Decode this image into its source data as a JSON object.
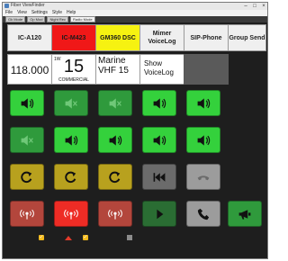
{
  "window": {
    "title": "Fiber ViewFinder"
  },
  "menu": [
    "File",
    "View",
    "Settings",
    "Style",
    "Help"
  ],
  "tabs": [
    "Gk Mode",
    "Op Mod",
    "Night Rec",
    "Radio Mode"
  ],
  "channels": [
    {
      "label": "IC-A120",
      "display": {
        "freq": "118.000"
      }
    },
    {
      "label": "IC-M423",
      "display": {
        "tag": "1W",
        "number": "15",
        "sub": "COMMERCIAL"
      }
    },
    {
      "label": "GM360 DSC",
      "display": {
        "text": "Marine VHF 15"
      }
    },
    {
      "label": "Mimer VoiceLog",
      "display": {
        "text": "Show VoiceLog"
      }
    },
    {
      "label": "SIP-Phone"
    },
    {
      "label": "Group Send"
    }
  ],
  "icons": {
    "speaker_on": "speaker-icon",
    "speaker_mute": "speaker-mute-icon",
    "replay": "replay-icon",
    "radio_tx": "radio-transmit-icon",
    "skip_back": "skip-back-icon",
    "play": "play-icon",
    "hangup": "hang-up-icon",
    "phone": "phone-icon",
    "megaphone": "megaphone-icon",
    "check": "checkmark-icon"
  },
  "colors": {
    "green_active": "#34d13c",
    "green_dim": "#2f9a3c",
    "yellow_button": "#b8a11e",
    "red_button": "#b3463c",
    "red_active": "#ee2c25",
    "header_red": "#f01818",
    "header_yellow": "#f6f211"
  }
}
